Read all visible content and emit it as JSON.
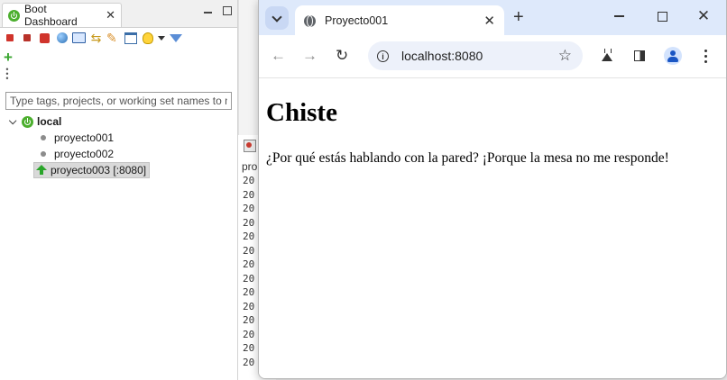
{
  "eclipse": {
    "view_tab": {
      "title": "Boot Dashboard",
      "close": "✕"
    },
    "filter": {
      "placeholder": "Type tags, projects, or working set names to m"
    },
    "tree": {
      "root_label": "local",
      "children": [
        {
          "label": "proyecto001",
          "state": "stopped"
        },
        {
          "label": "proyecto002",
          "state": "stopped"
        },
        {
          "label": "proyecto003 [:8080]",
          "state": "running"
        }
      ]
    },
    "console": {
      "header": "pro",
      "lines": [
        "20",
        "20",
        "20",
        "20",
        "20",
        "20",
        "20",
        "20",
        "20",
        "20",
        "20",
        "20",
        "20",
        "20"
      ]
    }
  },
  "browser": {
    "tab_title": "Proyecto001",
    "tab_close": "✕",
    "new_tab": "+",
    "url": "localhost:8080",
    "window_close": "✕",
    "nav": {
      "back": "←",
      "forward": "→",
      "reload": "↻"
    },
    "star": "☆",
    "page": {
      "heading": "Chiste",
      "paragraph": "¿Por qué estás hablando con la pared? ¡Porque la mesa no me responde!"
    }
  },
  "colors": {
    "chrome_titlebar": "#dee9fb",
    "omnibox": "#edf1fa",
    "spring_green": "#4caf2e",
    "running_green": "#2aa52a"
  }
}
